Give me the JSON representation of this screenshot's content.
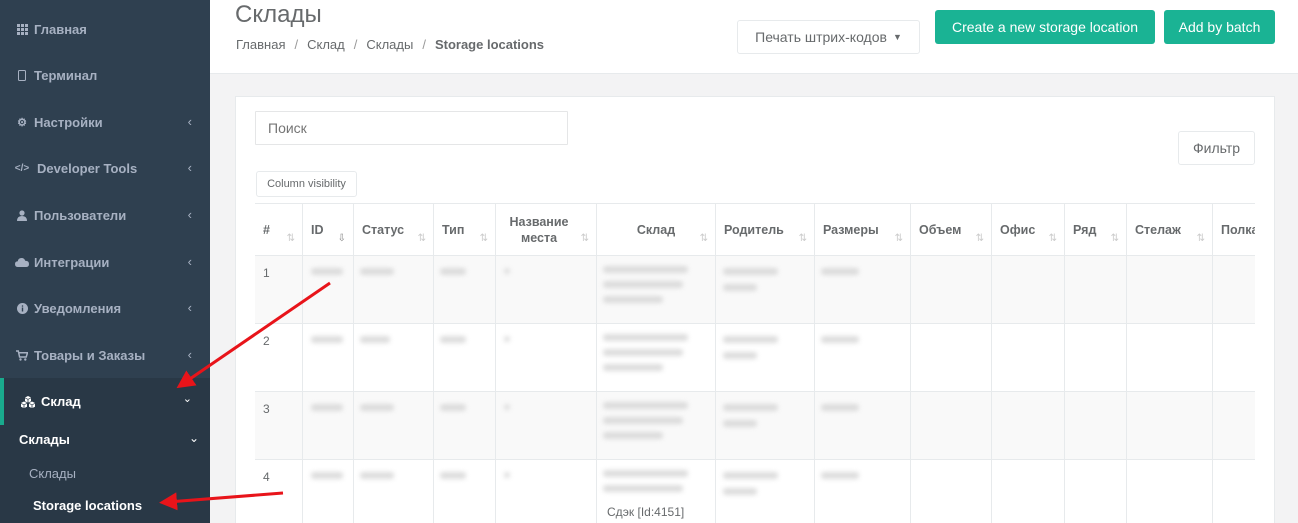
{
  "sidebar": {
    "items": [
      {
        "label": "Главная",
        "icon": "grid-icon",
        "chevron": false
      },
      {
        "label": "Терминал",
        "icon": "tablet-icon",
        "chevron": false
      },
      {
        "label": "Настройки",
        "icon": "gear-icon",
        "chevron": true
      },
      {
        "label": "Developer Tools",
        "icon": "code-icon",
        "chevron": true
      },
      {
        "label": "Пользователи",
        "icon": "user-icon",
        "chevron": true
      },
      {
        "label": "Интеграции",
        "icon": "cloud-icon",
        "chevron": true
      },
      {
        "label": "Уведомления",
        "icon": "info-icon",
        "chevron": true
      },
      {
        "label": "Товары и Заказы",
        "icon": "cart-icon",
        "chevron": true
      },
      {
        "label": "Склад",
        "icon": "cubes-icon",
        "chevron": true,
        "active": true
      }
    ],
    "submenu": {
      "group_label": "Склады",
      "items": [
        "Склады",
        "Storage locations"
      ],
      "active_item": "Storage locations"
    }
  },
  "header": {
    "title": "Склады",
    "breadcrumb": [
      "Главная",
      "Склад",
      "Склады",
      "Storage locations"
    ],
    "print_button": "Печать штрих-кодов",
    "create_button": "Create a new storage location",
    "batch_button": "Add by batch"
  },
  "toolbar": {
    "search_placeholder": "Поиск",
    "filter_button": "Фильтр",
    "column_visibility_button": "Column visibility"
  },
  "table": {
    "columns": [
      "#",
      "ID",
      "Статус",
      "Тип",
      "Название места",
      "Склад",
      "Родитель",
      "Размеры",
      "Объем",
      "Офис",
      "Ряд",
      "Стелаж",
      "Полка"
    ],
    "rows": [
      {
        "index": "1"
      },
      {
        "index": "2"
      },
      {
        "index": "3"
      },
      {
        "index": "4",
        "warehouse_text": "Сдэк [Id:4151]"
      }
    ]
  },
  "colors": {
    "sidebar_bg": "#2f4050",
    "accent": "#1ab394",
    "annotation_arrow": "#e8141a"
  }
}
